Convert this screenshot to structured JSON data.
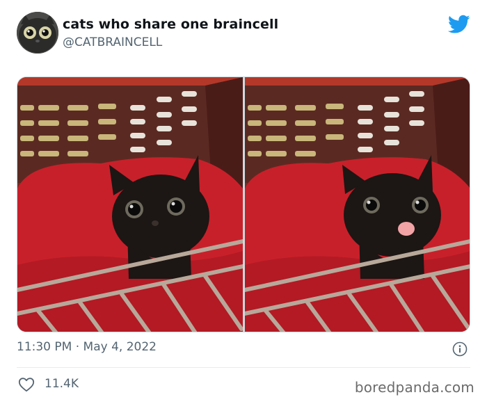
{
  "tweet": {
    "display_name": "cats who share one braincell",
    "handle": "@CATBRAINCELL",
    "timestamp": "11:30 PM · May 4, 2022",
    "likes": "11.4K"
  },
  "watermark": "boredpanda.com",
  "icons": {
    "brand": "twitter-bird-icon",
    "info": "info-icon",
    "like": "heart-icon"
  },
  "colors": {
    "twitter_blue": "#1d9bf0",
    "text_primary": "#0f1419",
    "text_secondary": "#536471",
    "divider": "#e7ecef"
  }
}
